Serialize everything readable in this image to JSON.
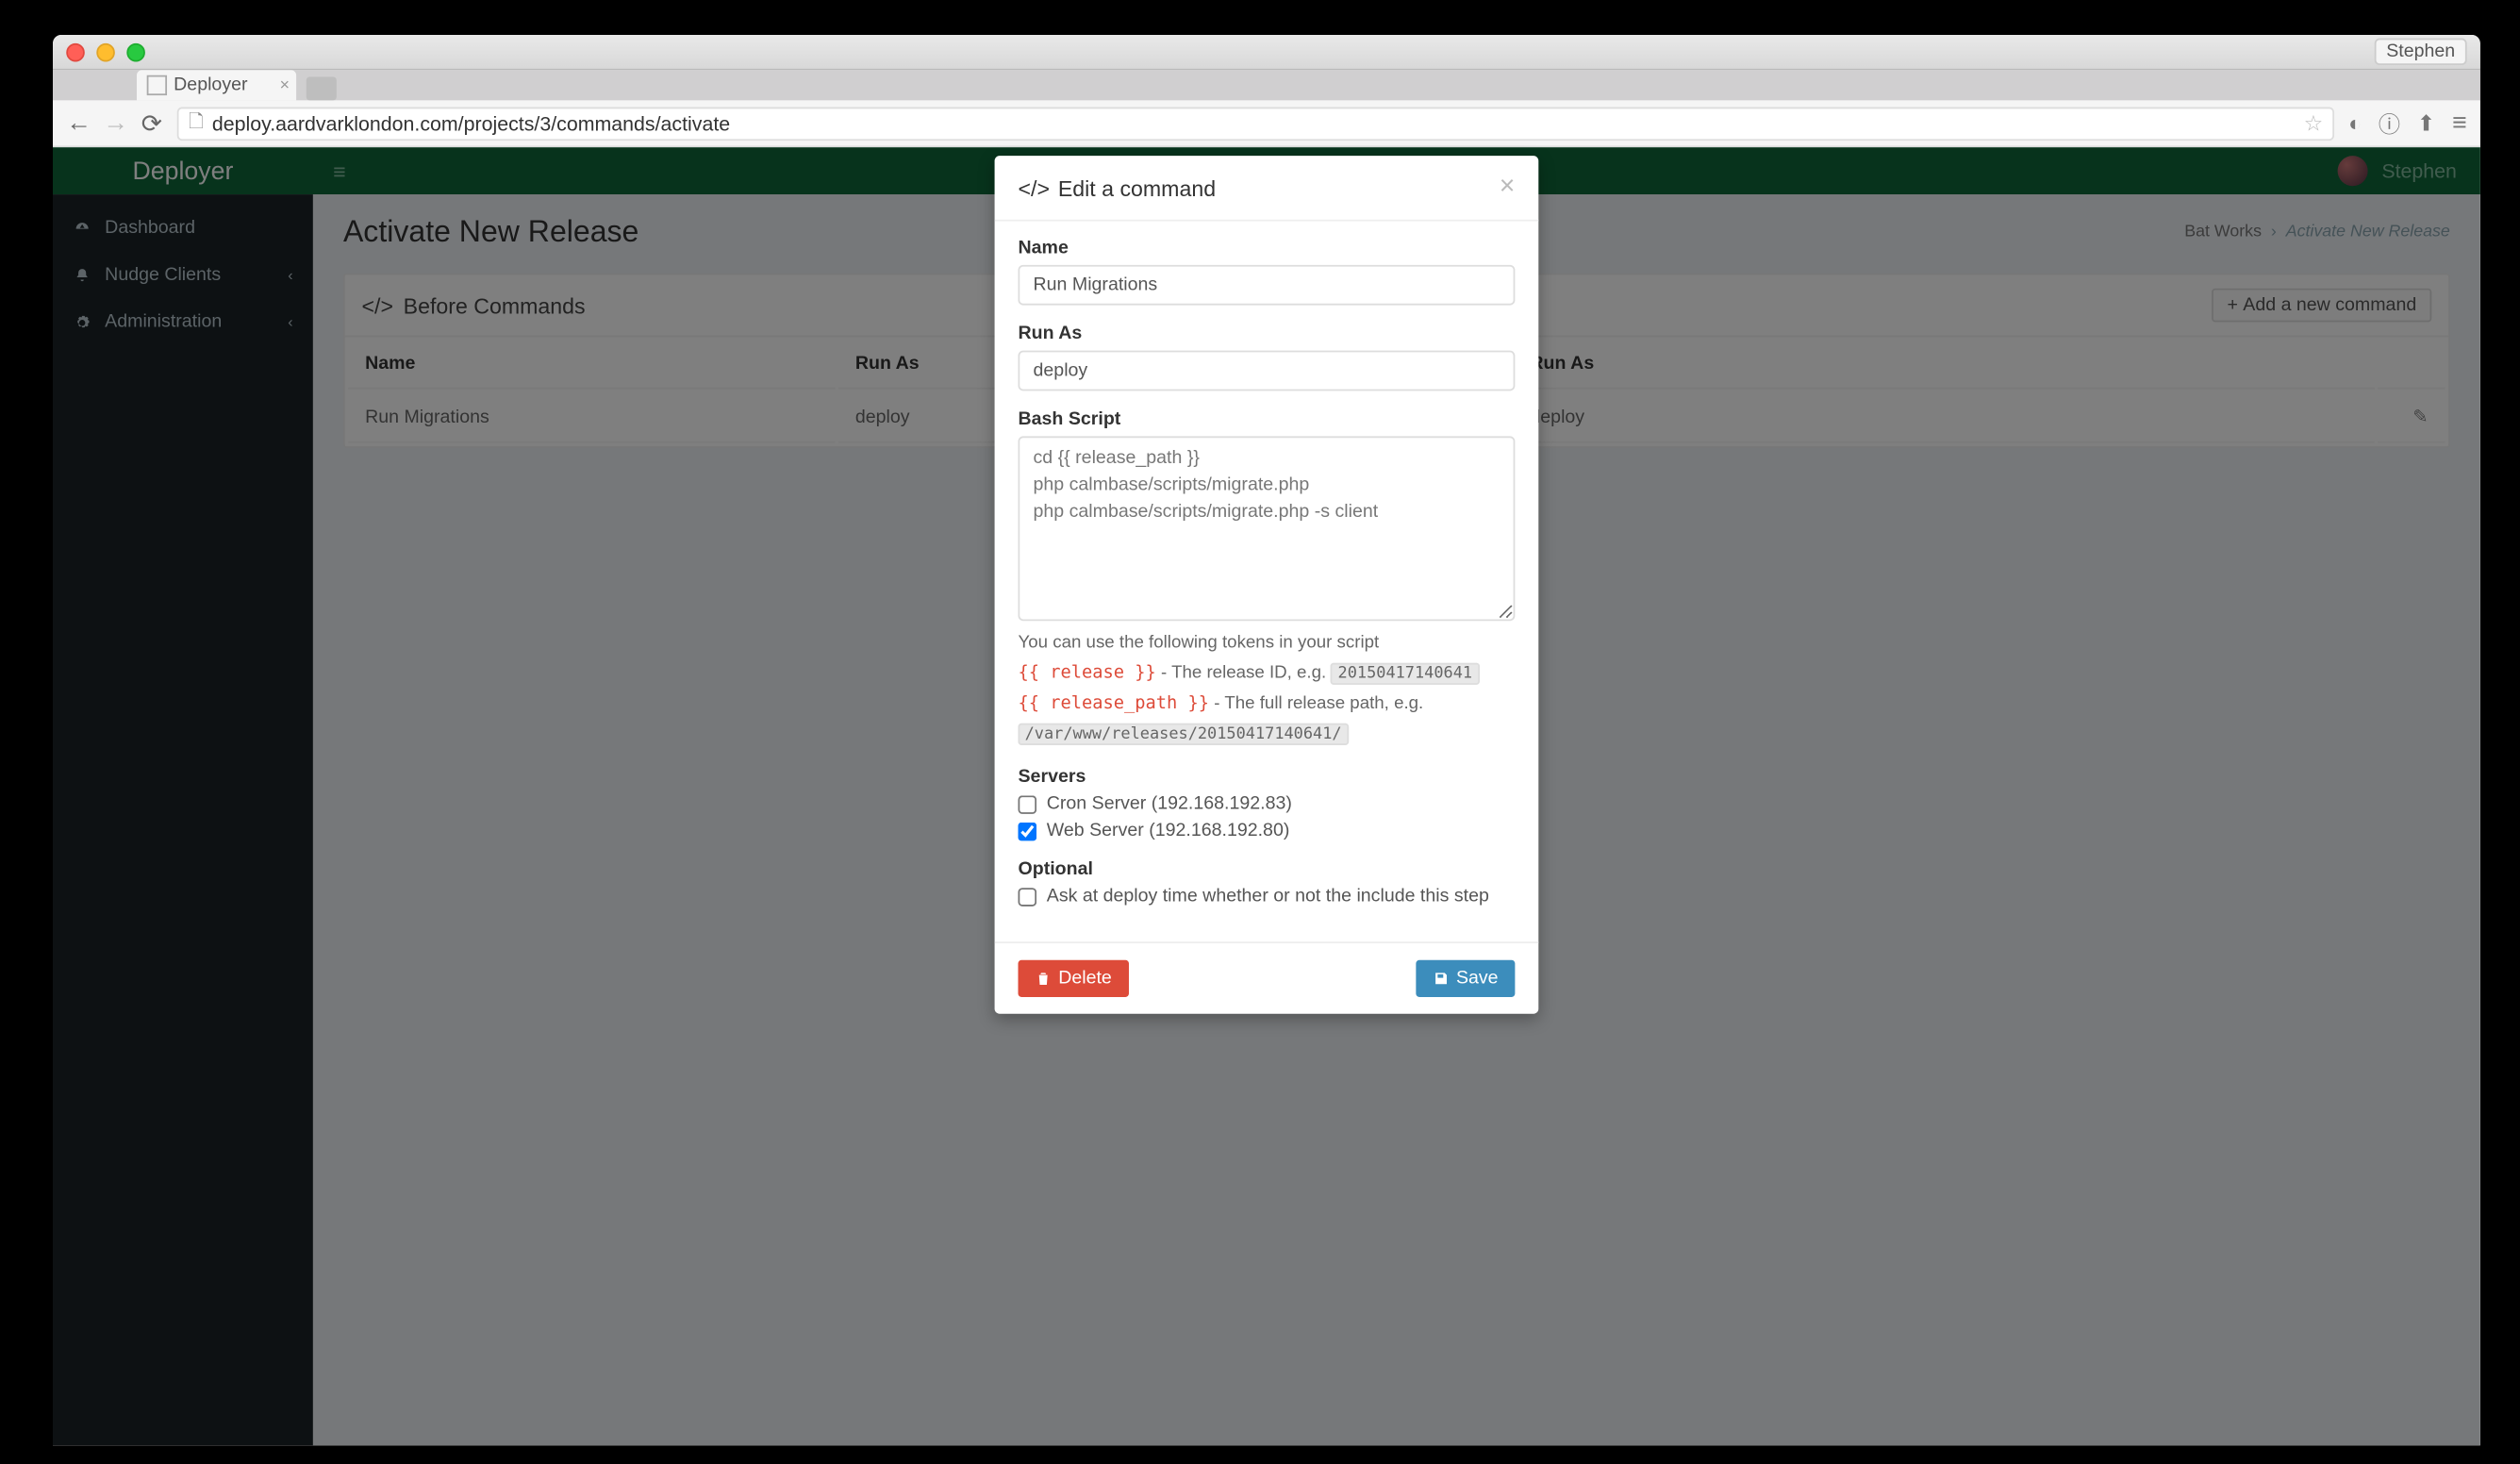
{
  "mac": {
    "profile": "Stephen"
  },
  "browser": {
    "tab_title": "Deployer",
    "url": "deploy.aardvarklondon.com/projects/3/commands/activate"
  },
  "header": {
    "brand": "Deployer",
    "user": "Stephen"
  },
  "sidebar": {
    "items": [
      {
        "label": "Dashboard"
      },
      {
        "label": "Nudge Clients"
      },
      {
        "label": "Administration"
      }
    ]
  },
  "page": {
    "title": "Activate New Release",
    "breadcrumb_project": "Bat Works",
    "breadcrumb_current": "Activate New Release"
  },
  "panel": {
    "title": "Before Commands",
    "add_label": "Add a new command",
    "columns": {
      "name": "Name",
      "run_as": "Run As"
    },
    "rows": [
      {
        "name": "Run Migrations",
        "run_as": "deploy"
      }
    ],
    "right_columns": {
      "run_as": "Run As"
    },
    "right_rows": [
      {
        "run_as": "deploy"
      }
    ]
  },
  "modal": {
    "title": "Edit a command",
    "labels": {
      "name": "Name",
      "run_as": "Run As",
      "bash": "Bash Script",
      "servers": "Servers",
      "optional": "Optional"
    },
    "values": {
      "name": "Run Migrations",
      "run_as": "deploy",
      "bash": "cd {{ release_path }}\nphp calmbase/scripts/migrate.php\nphp calmbase/scripts/migrate.php -s client"
    },
    "tokens_intro": "You can use the following tokens in your script",
    "tokens": {
      "release": "{{ release }}",
      "release_desc": " - The release ID, e.g. ",
      "release_ex": "20150417140641",
      "release_path": "{{ release_path }}",
      "release_path_desc": " - The full release path, e.g. ",
      "release_path_ex": "/var/www/releases/20150417140641/"
    },
    "servers": [
      {
        "label": "Cron Server (192.168.192.83)",
        "checked": false
      },
      {
        "label": "Web Server (192.168.192.80)",
        "checked": true
      }
    ],
    "optional_label": "Ask at deploy time whether or not the include this step",
    "buttons": {
      "delete": "Delete",
      "save": "Save"
    }
  }
}
